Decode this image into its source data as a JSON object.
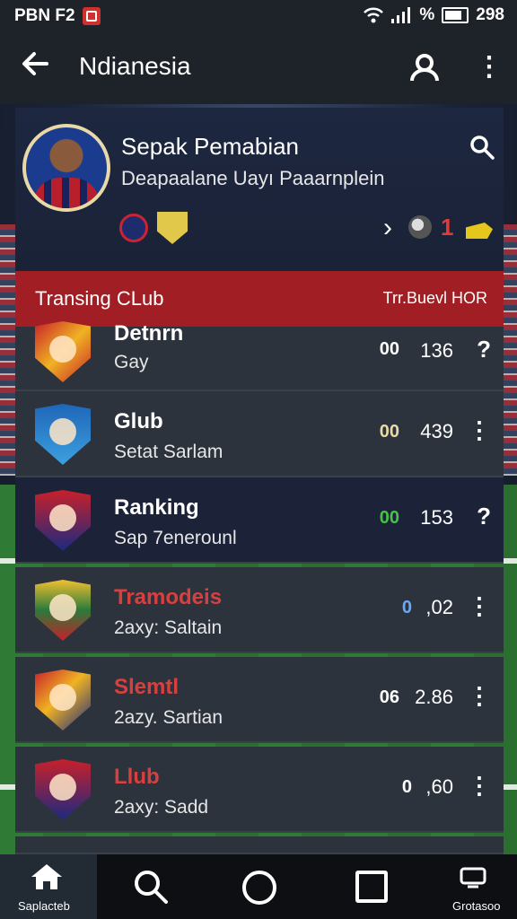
{
  "status_bar": {
    "left_text": "PBN F2",
    "battery_text": "%",
    "time": "298"
  },
  "app_bar": {
    "title": "Ndianesia",
    "back_icon": "arrow-left-icon",
    "user_icon": "user-icon",
    "more_icon": "more-vert-icon"
  },
  "profile": {
    "name": "Sepak Pemabian",
    "subtitle": "Deapaalane Uayı Paaarnplein",
    "count": "1",
    "chevron": "›"
  },
  "section": {
    "label": "Transing CLub",
    "right_label": "Trr.Buevl HOR"
  },
  "rows": [
    {
      "title": "Detnrn",
      "subtitle": "Gay",
      "icon_text": "00",
      "icon_color": "#ffffff",
      "value": "136",
      "more": "?"
    },
    {
      "title": "Glub",
      "subtitle": "Setat Sarlam",
      "icon_text": "00",
      "icon_color": "#e8d9a6",
      "value": "439",
      "more": "⋮"
    },
    {
      "title": "Ranking",
      "subtitle": "Sap   7enerounl",
      "icon_text": "00",
      "icon_color": "#46c24a",
      "value": "153",
      "more": "?"
    },
    {
      "title": "Tramodeis",
      "subtitle": "2axy: Saltain",
      "icon_text": "0",
      "icon_color": "#66aaff",
      "value": ",02",
      "more": "⋮"
    },
    {
      "title": "Slemtl",
      "subtitle": "2azy. Sartian",
      "icon_text": "06",
      "icon_color": "#ffffff",
      "value": "2.86",
      "more": "⋮"
    },
    {
      "title": "Llub",
      "subtitle": "2axy: Sadd",
      "icon_text": "0",
      "icon_color": "#ffffff",
      "value": ",60",
      "more": "⋮"
    }
  ],
  "bottom_nav": {
    "home_label": "Saplacteb",
    "game_label": "Grotasoo"
  },
  "colors": {
    "accent_red": "#a01e24",
    "row_bg": "#2d333c",
    "highlight_bg": "#1c2238"
  }
}
